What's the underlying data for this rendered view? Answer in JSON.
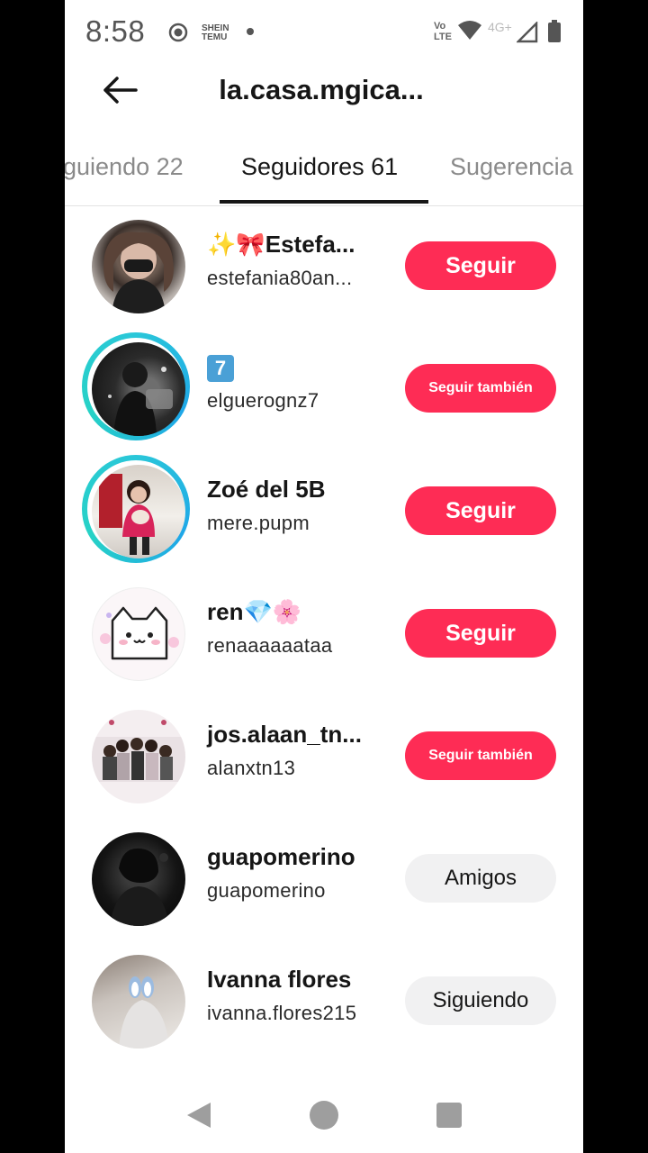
{
  "status_bar": {
    "time": "8:58",
    "app_icon_text": "Shein TEMU",
    "volte": "Vo LTE",
    "network": "4G+"
  },
  "header": {
    "title": "la.casa.mgica..."
  },
  "tabs": [
    {
      "label": "guiendo 22",
      "active": false
    },
    {
      "label": "Seguidores 61",
      "active": true
    },
    {
      "label": "Sugerencia",
      "active": false
    }
  ],
  "followers": [
    {
      "name": "✨🎀Estefa...",
      "username": "estefania80an...",
      "button": "Seguir",
      "button_style": "red"
    },
    {
      "name": "7",
      "username": "elguerognz7",
      "button": "Seguir también",
      "button_style": "red-small",
      "ring": true
    },
    {
      "name": "Zoé del 5B",
      "username": "mere.pupm",
      "button": "Seguir",
      "button_style": "red",
      "ring": true
    },
    {
      "name": "ren💎🌸",
      "username": "renaaaaaataa",
      "button": "Seguir",
      "button_style": "red"
    },
    {
      "name": "jos.alaan_tn...",
      "username": "alanxtn13",
      "button": "Seguir también",
      "button_style": "red-small"
    },
    {
      "name": "guapomerino",
      "username": "guapomerino",
      "button": "Amigos",
      "button_style": "grey"
    },
    {
      "name": "Ivanna flores",
      "username": "ivanna.flores215",
      "button": "Siguiendo",
      "button_style": "grey"
    }
  ],
  "colors": {
    "accent": "#fe2c55",
    "story_ring": "#2ac7d9",
    "grey_button": "#f1f1f2"
  }
}
